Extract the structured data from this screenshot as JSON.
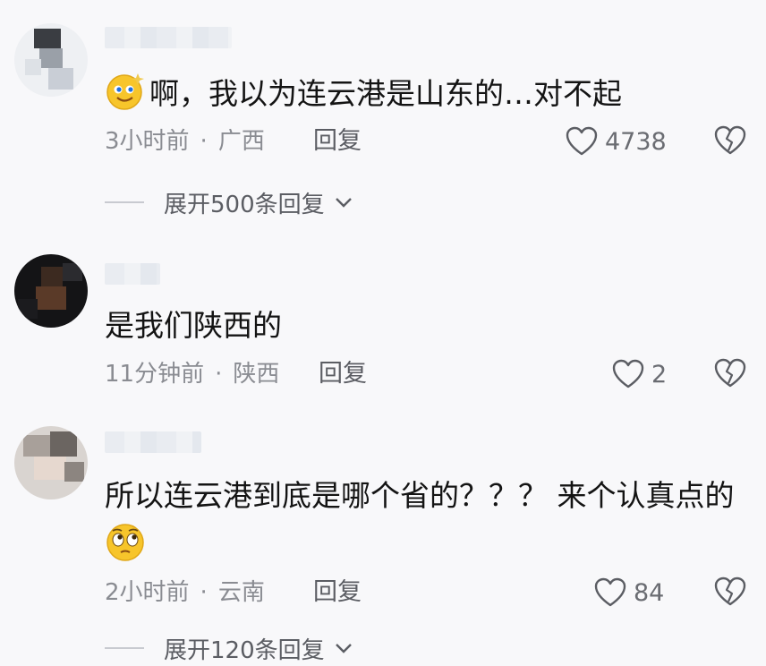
{
  "comments": [
    {
      "text": "啊，我以为连云港是山东的…对不起",
      "emoji": "smile-emoji",
      "time": "3小时前",
      "location": "广西",
      "reply_label": "回复",
      "likes": "4738",
      "expand_label": "展开500条回复"
    },
    {
      "text": "是我们陕西的",
      "time": "11分钟前",
      "location": "陕西",
      "reply_label": "回复",
      "likes": "2"
    },
    {
      "text": "所以连云港到底是哪个省的？？？ 来个认真点的",
      "emoji": "thinking-eyes-emoji",
      "time": "2小时前",
      "location": "云南",
      "reply_label": "回复",
      "likes": "84",
      "expand_label": "展开120条回复"
    }
  ],
  "meta_separator": "·",
  "colors": {
    "background": "#f8f8fa",
    "meta": "#8a8c92",
    "text": "#141414"
  }
}
